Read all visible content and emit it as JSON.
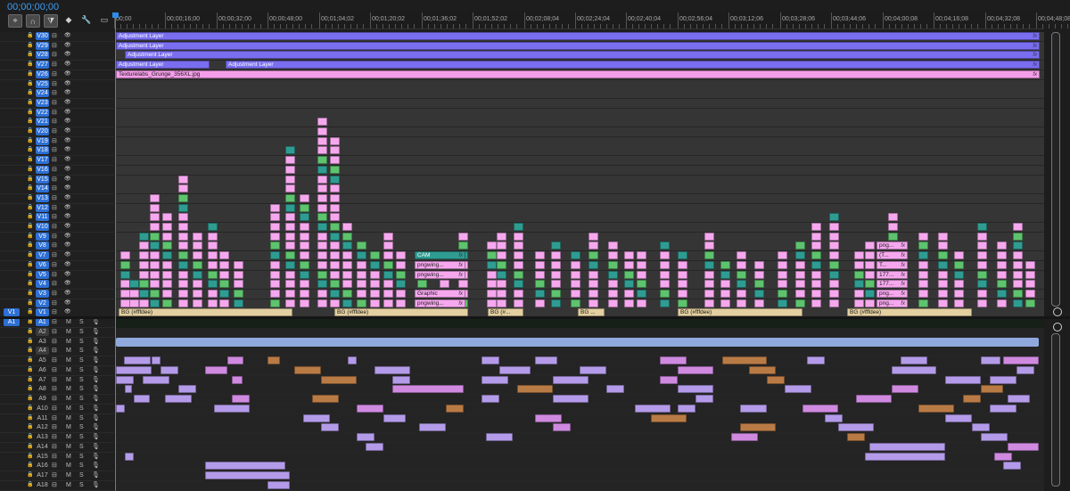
{
  "header": {
    "timecode": "00;00;00;00",
    "tools": [
      {
        "icon": "snap-icon",
        "glyph": "⌖"
      },
      {
        "icon": "linked-selection-icon",
        "glyph": "∩"
      },
      {
        "icon": "add-marker-icon",
        "glyph": "⧩"
      },
      {
        "icon": "marker-icon",
        "glyph": "◆"
      },
      {
        "icon": "wrench-icon",
        "glyph": "🔧"
      },
      {
        "icon": "captions-icon",
        "glyph": "▭"
      }
    ]
  },
  "ruler": {
    "labels": [
      "00;00",
      "00;00;16;00",
      "00;00;32;00",
      "00;00;48;00",
      "00;01;04;02",
      "00;01;20;02",
      "00;01;36;02",
      "00;01;52;02",
      "00;02;08;04",
      "00;02;24;04",
      "00;02;40;04",
      "00;02;56;04",
      "00;03;12;06",
      "00;03;28;06",
      "00;03;44;06",
      "00;04;00;08",
      "00;04;16;08",
      "00;04;32;08",
      "00;04;48;08"
    ]
  },
  "video_tracks": [
    "V30",
    "V29",
    "V28",
    "V27",
    "V26",
    "V25",
    "V24",
    "V23",
    "V22",
    "V21",
    "V20",
    "V19",
    "V18",
    "V17",
    "V16",
    "V15",
    "V14",
    "V13",
    "V12",
    "V11",
    "V10",
    "V9",
    "V8",
    "V7",
    "V6",
    "V5",
    "V4",
    "V3",
    "V2",
    "V1"
  ],
  "source_patch_video": "V1",
  "audio_tracks": [
    "A1",
    "A2",
    "A3",
    "A4",
    "A5",
    "A6",
    "A7",
    "A8",
    "A9",
    "A10",
    "A11",
    "A12",
    "A13",
    "A14",
    "A15",
    "A16",
    "A17",
    "A18"
  ],
  "source_patch_audio": "A1",
  "audio_buttons": {
    "mute": "M",
    "solo": "S"
  },
  "clips": {
    "adjustment_layer": "Adjustment Layer",
    "adjustment_layer_2": "Adjustment Layer",
    "adjustment_layer_3": "Adjustment Layer",
    "adjustment_layer_4": "Adjustment Layer",
    "adjustment_layer_5": "Adjustment Layer",
    "texture": "Texturelabs_Grunge_356XL.jpg",
    "bg": "BG (#fffdee)",
    "bg_short": "BG (#...",
    "bg_shorter": "BG ...",
    "cam": "CAM",
    "pngwing": "pngwing...",
    "graphic": "Graphic",
    "png": "png...",
    "t_short": "(T...",
    "t_short2": "T...",
    "n177": "177...",
    "fx": "fx"
  },
  "colors": {
    "adjustment": "#7a6ef0",
    "texture": "#f49ee9",
    "pink": "#f6a8ee",
    "teal": "#2f9c92",
    "green": "#5ec36e",
    "tan": "#e3cfa0",
    "purple": "#b49be9",
    "audio_blue": "#8fa9dd"
  }
}
